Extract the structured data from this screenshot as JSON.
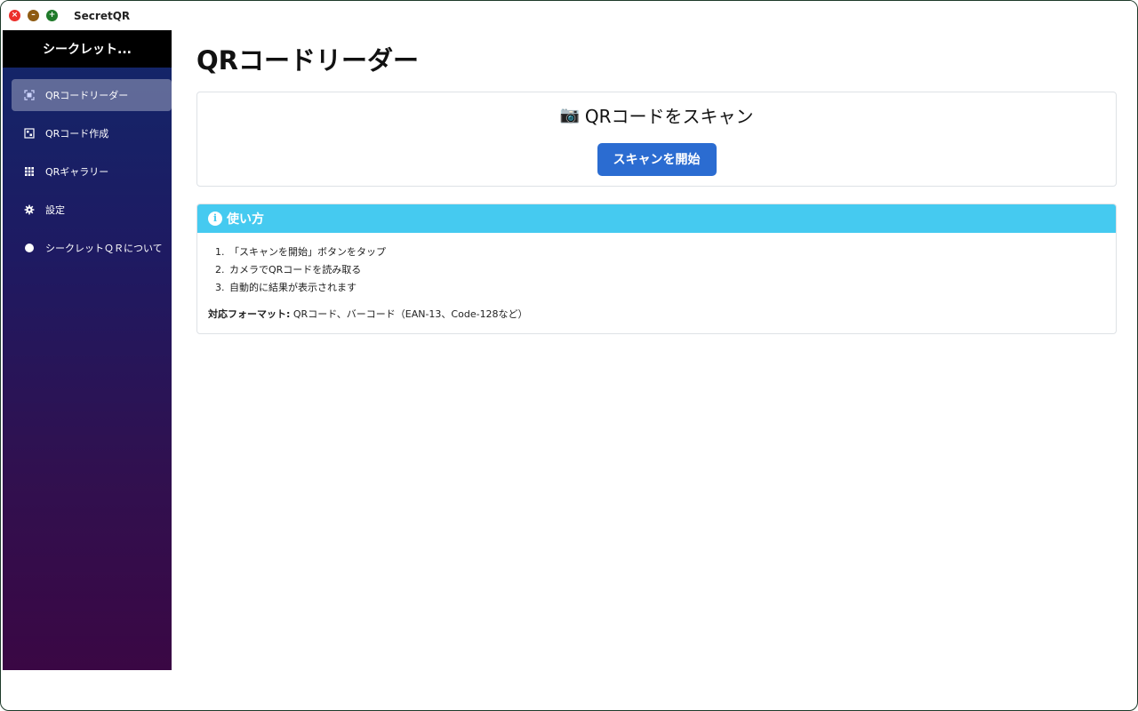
{
  "window": {
    "title": "SecretQR"
  },
  "sidebar": {
    "header": "シークレット...",
    "items": [
      {
        "label": "QRコードリーダー",
        "icon": "qr-scan-icon",
        "active": true
      },
      {
        "label": "QRコード作成",
        "icon": "qr-create-icon",
        "active": false
      },
      {
        "label": "QRギャラリー",
        "icon": "grid-icon",
        "active": false
      },
      {
        "label": "設定",
        "icon": "gear-icon",
        "active": false
      },
      {
        "label": "シークレットＱＲについて",
        "icon": "info-circle-icon",
        "active": false
      }
    ]
  },
  "main": {
    "title": "QRコードリーダー",
    "scan_card": {
      "heading": "QRコードをスキャン",
      "button_label": "スキャンを開始"
    },
    "info_card": {
      "header": "使い方",
      "steps": [
        {
          "num": "1.",
          "text": "「スキャンを開始」ボタンをタップ"
        },
        {
          "num": "2.",
          "text": "カメラでQRコードを読み取る"
        },
        {
          "num": "3.",
          "text": "自動的に結果が表示されます"
        }
      ],
      "formats_label": "対応フォーマット:",
      "formats_value": " QRコード、バーコード（EAN-13、Code-128など）"
    }
  },
  "colors": {
    "accent": "#2b6cd1",
    "info": "#45caf0",
    "sidebar_top": "#12276a",
    "sidebar_bottom": "#3a0744"
  }
}
